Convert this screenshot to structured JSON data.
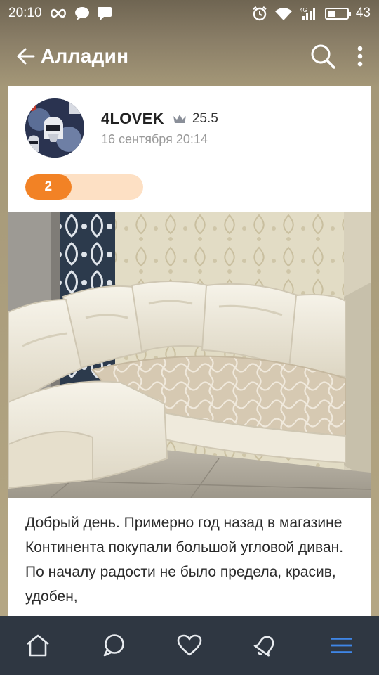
{
  "status_bar": {
    "time": "20:10",
    "battery_level": "43",
    "left_icons": [
      "infinity-icon",
      "chat-bubble-icon",
      "message-icon"
    ],
    "right_icons": [
      "alarm-icon",
      "wifi-icon",
      "signal-4g-icon",
      "battery-icon"
    ]
  },
  "app_bar": {
    "title": "Алладин",
    "back_icon": "back-arrow-icon",
    "search_icon": "search-icon",
    "menu_icon": "more-vertical-icon"
  },
  "post": {
    "author_name": "4LOVEK",
    "author_rating": "25.5",
    "rating_icon": "crown-icon",
    "date": "16 сентября 20:14",
    "progress_count": "2",
    "progress_fraction": 0.39,
    "text": "Добрый день. Примерно год назад в магазине Континента покупали большой угловой диван. По началу радости не было предела, красив, удобен,"
  },
  "bottom_nav": {
    "items": [
      {
        "icon": "home-icon"
      },
      {
        "icon": "chat-icon"
      },
      {
        "icon": "heart-icon"
      },
      {
        "icon": "bell-icon"
      },
      {
        "icon": "menu-icon",
        "active": true
      }
    ],
    "active_color": "#3f86e6",
    "inactive_color": "#e8ebef"
  },
  "colors": {
    "accent_orange": "#f28225",
    "progress_track": "#fde0c4",
    "nav_background": "#2f3742"
  }
}
